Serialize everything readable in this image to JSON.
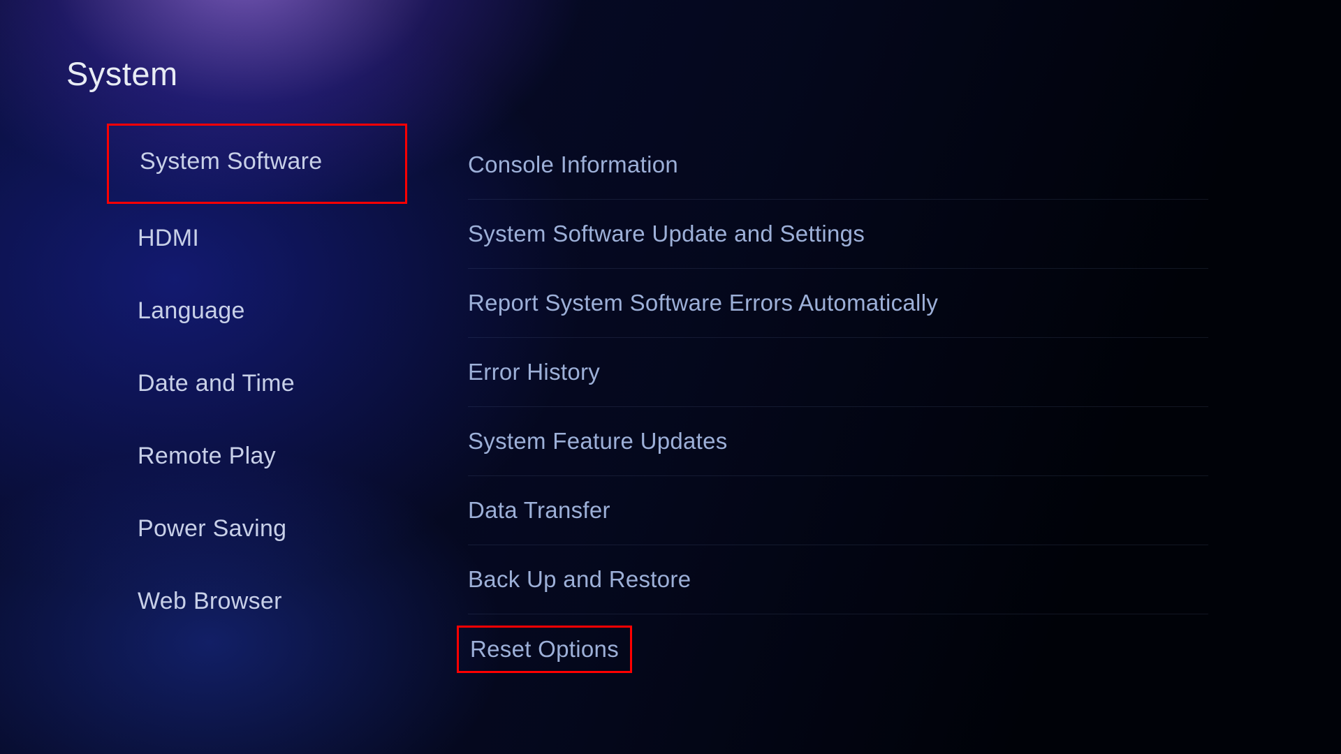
{
  "page": {
    "title": "System"
  },
  "sidebar": {
    "items": [
      {
        "label": "System Software",
        "highlighted": true
      },
      {
        "label": "HDMI",
        "highlighted": false
      },
      {
        "label": "Language",
        "highlighted": false
      },
      {
        "label": "Date and Time",
        "highlighted": false
      },
      {
        "label": "Remote Play",
        "highlighted": false
      },
      {
        "label": "Power Saving",
        "highlighted": false
      },
      {
        "label": "Web Browser",
        "highlighted": false
      }
    ]
  },
  "main": {
    "items": [
      {
        "label": "Console Information",
        "highlighted": false
      },
      {
        "label": "System Software Update and Settings",
        "highlighted": false
      },
      {
        "label": "Report System Software Errors Automatically",
        "highlighted": false
      },
      {
        "label": "Error History",
        "highlighted": false
      },
      {
        "label": "System Feature Updates",
        "highlighted": false
      },
      {
        "label": "Data Transfer",
        "highlighted": false
      },
      {
        "label": "Back Up and Restore",
        "highlighted": false
      },
      {
        "label": "Reset Options",
        "highlighted": true
      }
    ]
  }
}
